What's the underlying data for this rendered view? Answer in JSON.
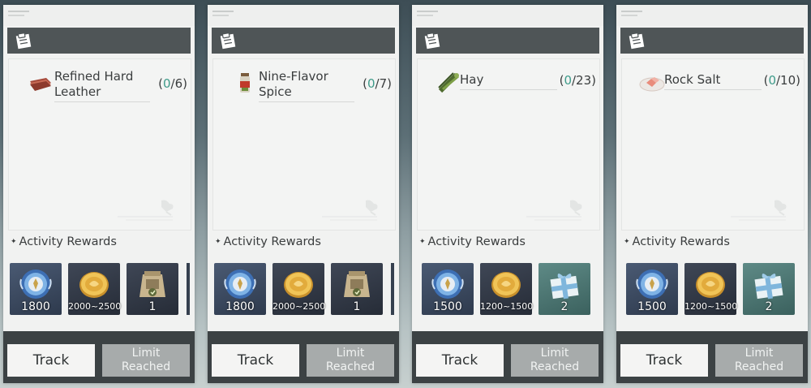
{
  "cards": [
    {
      "item_name": "Refined Hard Leather",
      "item_icon": "leather-icon",
      "count_open": "(",
      "count_current": "0",
      "count_rest": "/6)",
      "rewards_title": "Activity Rewards",
      "rewards": [
        {
          "icon": "activity-medal-icon",
          "qty": "1800"
        },
        {
          "icon": "gold-coin-icon",
          "qty": "2000~2500"
        },
        {
          "icon": "supply-sack-icon",
          "qty": "1"
        }
      ],
      "track_label": "Track",
      "limit_label": "Limit Reached"
    },
    {
      "item_name": "Nine-Flavor Spice",
      "item_icon": "spice-jar-icon",
      "count_open": "(",
      "count_current": "0",
      "count_rest": "/7)",
      "rewards_title": "Activity Rewards",
      "rewards": [
        {
          "icon": "activity-medal-icon",
          "qty": "1800"
        },
        {
          "icon": "gold-coin-icon",
          "qty": "2000~2500"
        },
        {
          "icon": "supply-sack-icon",
          "qty": "1"
        }
      ],
      "track_label": "Track",
      "limit_label": "Limit Reached"
    },
    {
      "item_name": "Hay",
      "item_icon": "hay-icon",
      "count_open": "(",
      "count_current": "0",
      "count_rest": "/23)",
      "rewards_title": "Activity Rewards",
      "rewards": [
        {
          "icon": "activity-medal-icon",
          "qty": "1500"
        },
        {
          "icon": "gold-coin-icon",
          "qty": "1200~1500"
        },
        {
          "icon": "gift-box-icon",
          "qty": "2"
        }
      ],
      "track_label": "Track",
      "limit_label": "Limit Reached"
    },
    {
      "item_name": "Rock Salt",
      "item_icon": "rock-salt-icon",
      "count_open": "(",
      "count_current": "0",
      "count_rest": "/10)",
      "rewards_title": "Activity Rewards",
      "rewards": [
        {
          "icon": "activity-medal-icon",
          "qty": "1500"
        },
        {
          "icon": "gold-coin-icon",
          "qty": "1200~1500"
        },
        {
          "icon": "gift-box-icon",
          "qty": "2"
        }
      ],
      "track_label": "Track",
      "limit_label": "Limit Reached"
    }
  ],
  "colors": {
    "count_current": "#3f9b8a",
    "header_bar": "#4f5557",
    "bottom_bar": "#3c4244",
    "limit_button": "#a7abab"
  }
}
